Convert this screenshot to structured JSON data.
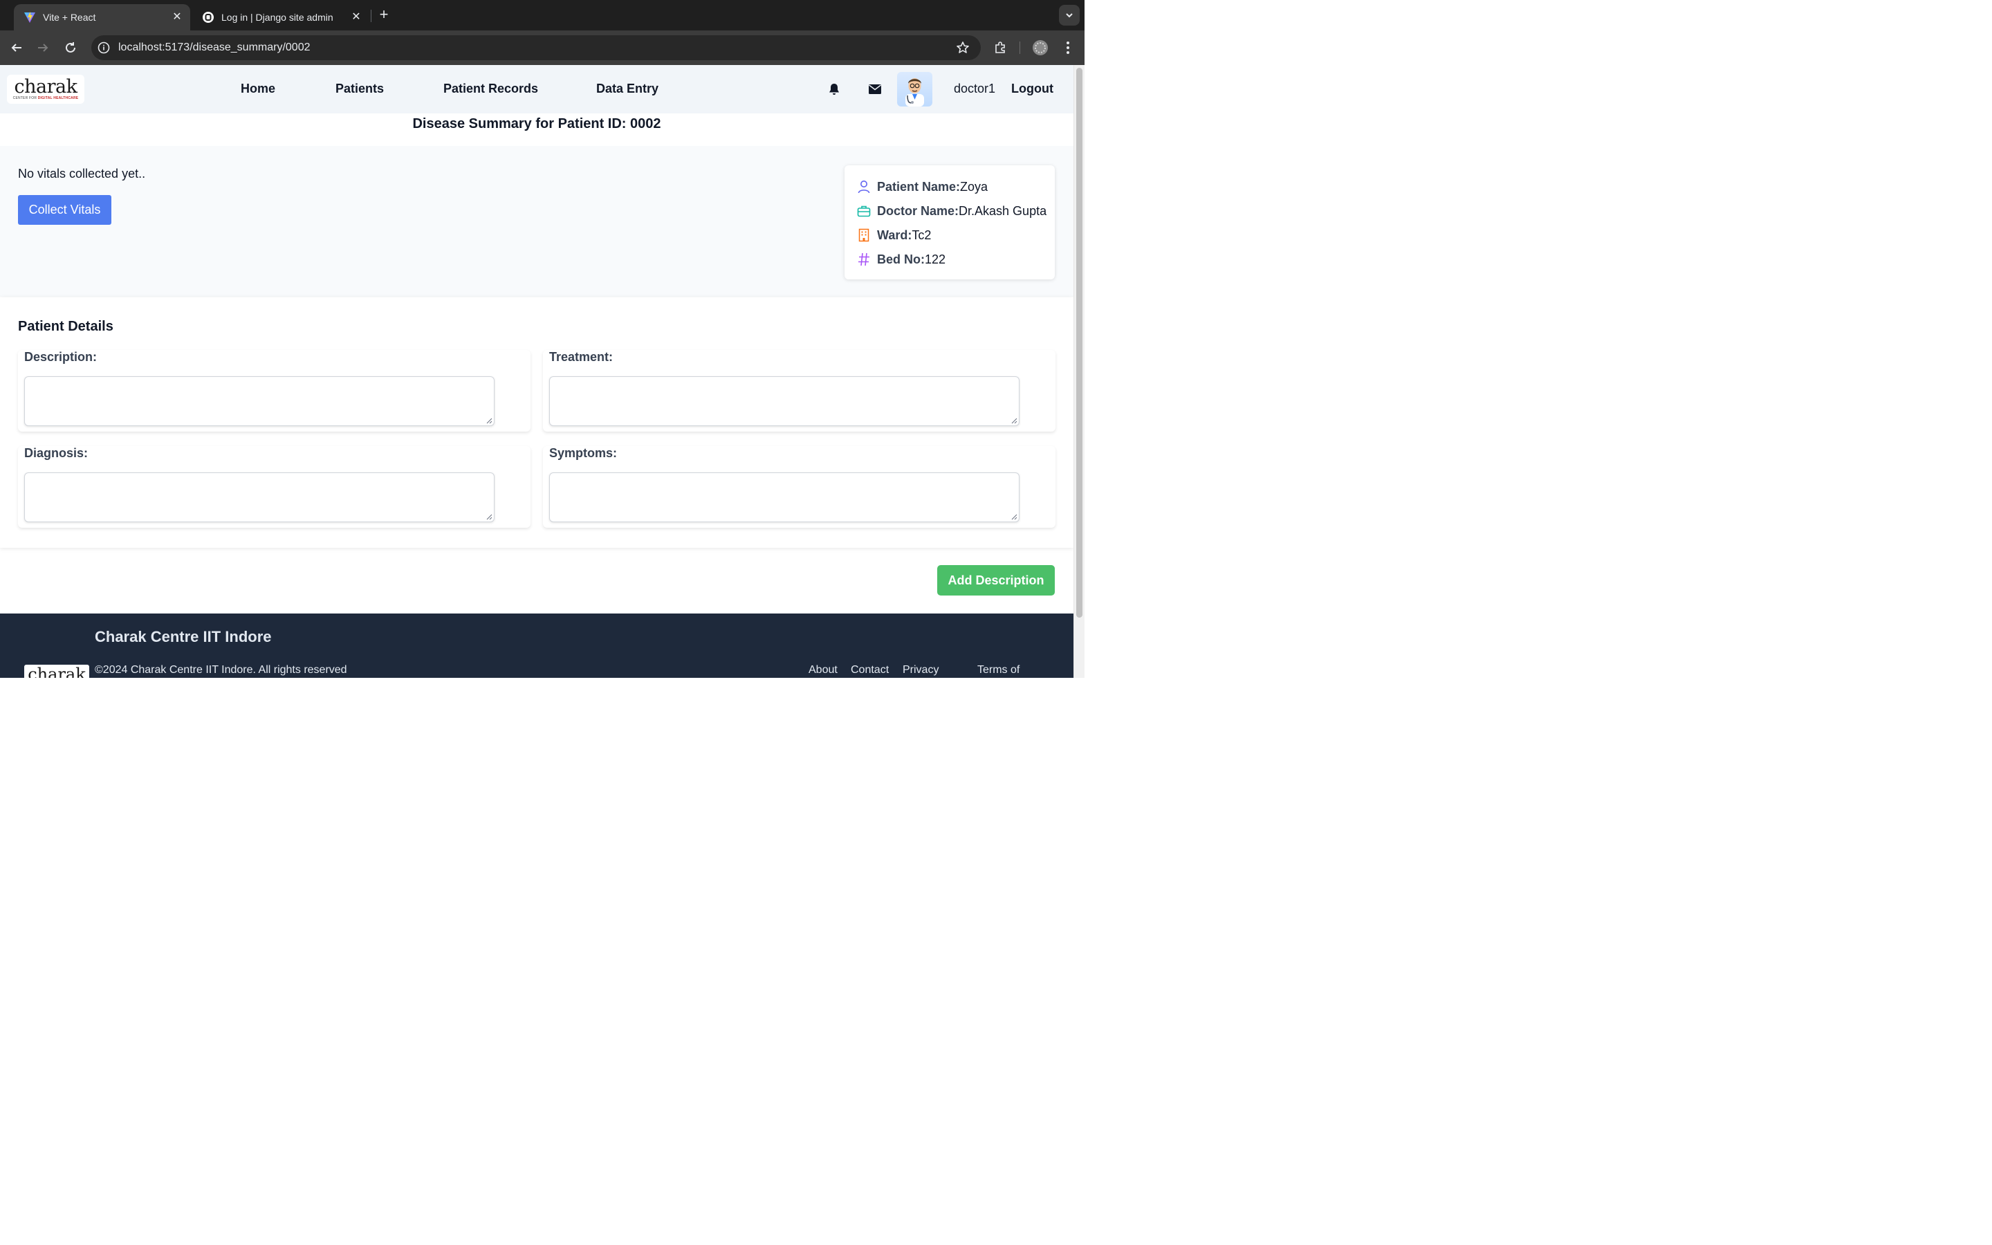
{
  "browser": {
    "tabs": [
      {
        "title": "Vite + React",
        "active": true,
        "favicon": "vite-logo-icon"
      },
      {
        "title": "Log in | Django site admin",
        "active": false,
        "favicon": "django-globe-icon"
      }
    ],
    "url": "localhost:5173/disease_summary/0002"
  },
  "navbar": {
    "logo_text": "charak",
    "logo_subtitle": "CENTER FOR",
    "logo_subtitle_accent": "DIGITAL HEALTHCARE",
    "links": [
      "Home",
      "Patients",
      "Patient Records",
      "Data Entry"
    ],
    "username": "doctor1",
    "logout_label": "Logout"
  },
  "summary": {
    "title": "Disease Summary for Patient ID: 0002"
  },
  "vitals": {
    "message": "No vitals collected yet..",
    "collect_button": "Collect Vitals"
  },
  "patient_card": {
    "name_label": "Patient Name:",
    "name_value": "Zoya",
    "doctor_label": "Doctor Name:",
    "doctor_value": "Dr.Akash Gupta",
    "ward_label": "Ward:",
    "ward_value": "Tc2",
    "bed_label": "Bed No:",
    "bed_value": "122"
  },
  "details": {
    "title": "Patient Details",
    "fields": {
      "description": {
        "label": "Description:",
        "value": ""
      },
      "treatment": {
        "label": "Treatment:",
        "value": ""
      },
      "diagnosis": {
        "label": "Diagnosis:",
        "value": ""
      },
      "symptoms": {
        "label": "Symptoms:",
        "value": ""
      }
    },
    "add_button": "Add Description"
  },
  "footer": {
    "title": "Charak Centre IIT Indore",
    "logo_text": "charak",
    "copyright": "©2024 Charak Centre IIT Indore. All rights reserved",
    "links": [
      "About",
      "Contact",
      "Privacy",
      "Terms of"
    ]
  },
  "colors": {
    "primary_button": "#4f7cf0",
    "success_button": "#4bbf68",
    "footer_bg": "#1e293b",
    "navbar_bg": "#f1f5f9"
  }
}
